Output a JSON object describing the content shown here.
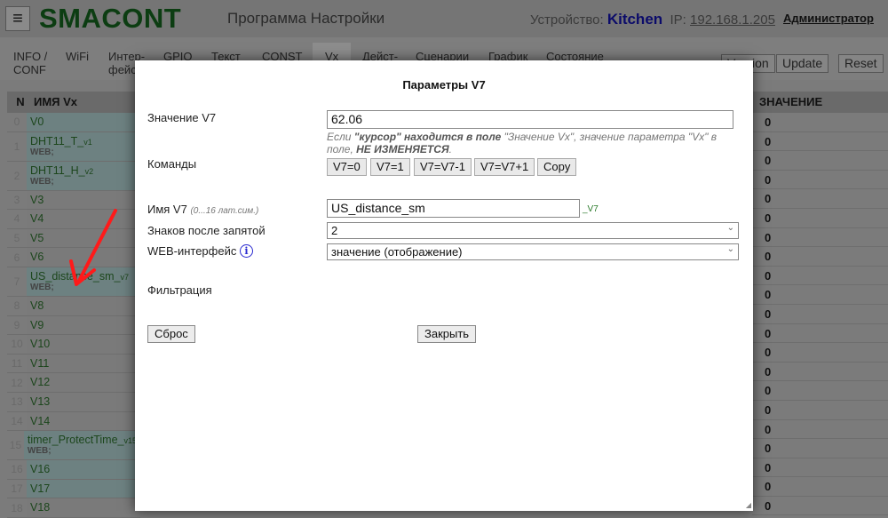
{
  "header": {
    "logo": "SMACONT",
    "subtitle": "Программа Настройки",
    "device_label": "Устройство:",
    "device_name": "Kitchen",
    "ip_label": "IP:",
    "ip": "192.168.1.205",
    "user": "Администратор",
    "menu_icon": "hamburger-icon"
  },
  "tabs": [
    {
      "label": "INFO /\nCONF"
    },
    {
      "label": "WiFi"
    },
    {
      "label": "Интер-\nфейс"
    },
    {
      "label": "GPIO"
    },
    {
      "label": "Текст"
    },
    {
      "label": "CONST"
    },
    {
      "label": "Vx"
    },
    {
      "label": "Дейст-"
    },
    {
      "label": "Сценарии"
    },
    {
      "label": "График"
    },
    {
      "label": "Состояние"
    }
  ],
  "toolbar": {
    "version": "Version",
    "update": "Update",
    "reset": "Reset"
  },
  "left_table": {
    "col_n": "N",
    "col_name": "ИМЯ Vx",
    "rows": [
      {
        "n": "0",
        "name": "V0",
        "sub": "",
        "hl": true
      },
      {
        "n": "1",
        "name": "DHT11_T_",
        "suffix": "v1",
        "sub": "WEB;",
        "hl": true
      },
      {
        "n": "2",
        "name": "DHT11_H_",
        "suffix": "v2",
        "sub": "WEB;",
        "hl": true
      },
      {
        "n": "3",
        "name": "V3",
        "sub": ""
      },
      {
        "n": "4",
        "name": "V4",
        "sub": ""
      },
      {
        "n": "5",
        "name": "V5",
        "sub": ""
      },
      {
        "n": "6",
        "name": "V6",
        "sub": ""
      },
      {
        "n": "7",
        "name": "US_distance_sm_",
        "suffix": "v7",
        "sub": "WEB;",
        "hl": true
      },
      {
        "n": "8",
        "name": "V8",
        "sub": ""
      },
      {
        "n": "9",
        "name": "V9",
        "sub": ""
      },
      {
        "n": "10",
        "name": "V10",
        "sub": ""
      },
      {
        "n": "11",
        "name": "V11",
        "sub": ""
      },
      {
        "n": "12",
        "name": "V12",
        "sub": ""
      },
      {
        "n": "13",
        "name": "V13",
        "sub": ""
      },
      {
        "n": "14",
        "name": "V14",
        "sub": ""
      },
      {
        "n": "15",
        "name": "timer_ProtectTime_",
        "suffix": "v15",
        "sub": "WEB;",
        "hl": true
      },
      {
        "n": "16",
        "name": "V16",
        "sub": "",
        "hl": true
      },
      {
        "n": "17",
        "name": "V17",
        "sub": "",
        "hl": true
      },
      {
        "n": "18",
        "name": "V18",
        "sub": ""
      }
    ]
  },
  "right_table": {
    "col_value": "ЗНАЧЕНИЕ",
    "values": [
      "0",
      "0",
      "0",
      "0",
      "0",
      "0",
      "0",
      "0",
      "0",
      "0",
      "0",
      "0",
      "0",
      "0",
      "0",
      "0",
      "0",
      "0",
      "0",
      "0",
      "0"
    ]
  },
  "modal": {
    "title": "Параметры V7",
    "value_label": "Значение V7",
    "value": "62.06",
    "note_a": "Если ",
    "note_b": "\"курсор\" находится в поле ",
    "note_c": "\"Значение Vx\", значение параметра \"Vx\" в поле, ",
    "note_d": "НЕ ИЗМЕНЯЕТСЯ",
    "note_e": ".",
    "commands_label": "Команды",
    "commands": [
      "V7=0",
      "V7=1",
      "V7=V7-1",
      "V7=V7+1",
      "Copy"
    ],
    "name_label": "Имя V7",
    "name_hint": "(0...16 лат.сим.)",
    "name_value": "US_distance_sm",
    "name_suffix": "_V7",
    "decimals_label": "Знаков после запятой",
    "decimals_value": "2",
    "web_label": "WEB-интерфейс",
    "web_value": "значение (отображение)",
    "filter_label": "Фильтрация",
    "reset_button": "Сброс",
    "close_button": "Закрыть"
  },
  "colors": {
    "logo": "#0c3d12",
    "device": "#0b0b6a",
    "annotation_arrow": "#ff0000"
  }
}
